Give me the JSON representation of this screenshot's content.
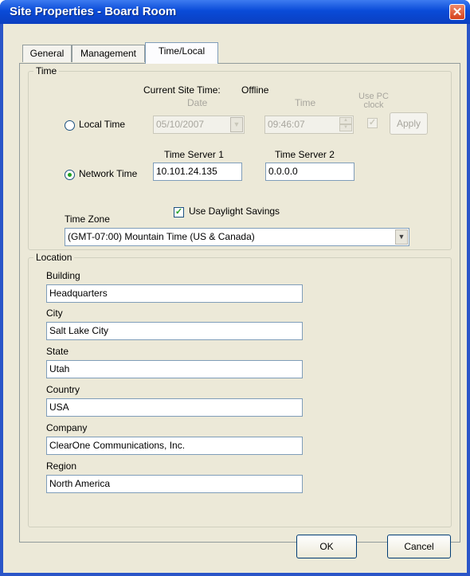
{
  "window": {
    "title": "Site Properties - Board Room",
    "close_icon": "close-icon"
  },
  "tabs": [
    "General",
    "Management",
    "Time/Local"
  ],
  "active_tab": "Time/Local",
  "time_group": {
    "legend": "Time",
    "current_site_time_label": "Current Site Time:",
    "current_site_time_value": "Offline",
    "local_time": {
      "label": "Local Time",
      "selected": false
    },
    "date_label": "Date",
    "date_value": "05/10/2007",
    "time_label": "Time",
    "time_value": "09:46:07",
    "use_pc_clock_label": "Use PC clock",
    "apply_label": "Apply",
    "network_time": {
      "label": "Network Time",
      "selected": true
    },
    "time_server_1_label": "Time Server 1",
    "time_server_1_value": "10.101.24.135",
    "time_server_2_label": "Time Server 2",
    "time_server_2_value": "0.0.0.0",
    "daylight_savings_label": "Use Daylight Savings",
    "daylight_savings_checked": true,
    "time_zone_label": "Time Zone",
    "time_zone_value": "(GMT-07:00) Mountain Time (US & Canada)"
  },
  "location_group": {
    "legend": "Location",
    "fields": [
      {
        "label": "Building",
        "value": "Headquarters"
      },
      {
        "label": "City",
        "value": "Salt Lake City"
      },
      {
        "label": "State",
        "value": "Utah"
      },
      {
        "label": "Country",
        "value": "USA"
      },
      {
        "label": "Company",
        "value": "ClearOne Communications, Inc."
      },
      {
        "label": "Region",
        "value": "North America"
      }
    ]
  },
  "buttons": {
    "ok": "OK",
    "cancel": "Cancel"
  }
}
